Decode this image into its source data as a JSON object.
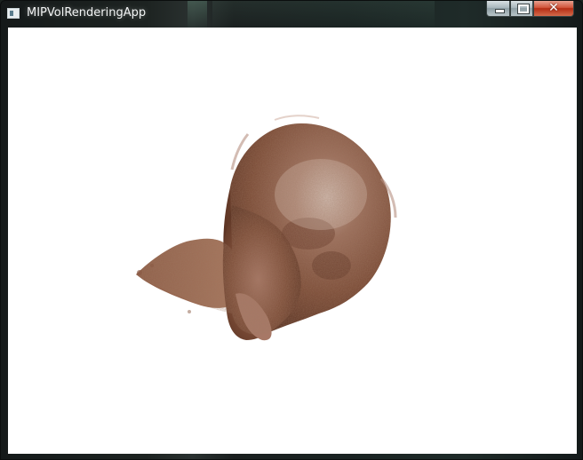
{
  "window": {
    "title": "MIPVolRenderingApp",
    "app_icon": "application-window-icon",
    "caption_buttons": {
      "minimize_icon": "minimize-icon",
      "maximize_icon": "maximize-icon",
      "close_icon": "close-icon"
    }
  },
  "viewport": {
    "background": "#ffffff",
    "content": "volume-rendered-head",
    "tissue_color": "#8a5a44"
  }
}
